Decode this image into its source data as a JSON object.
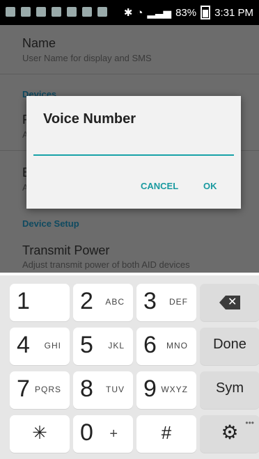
{
  "status_bar": {
    "battery_percent": "83%",
    "time": "3:31 PM",
    "icons": [
      "message-icon",
      "app-icon",
      "app-icon",
      "app-icon",
      "instagram-icon",
      "keyboard-icon",
      "image-icon",
      "bluetooth-icon",
      "wifi-icon",
      "signal-icon",
      "battery-icon"
    ]
  },
  "settings": {
    "name": {
      "title": "Name",
      "subtitle": "User Name for display and SMS"
    },
    "devices_section": "Devices",
    "device_setup_section": "Device Setup",
    "transmit_power": {
      "title": "Transmit Power",
      "subtitle": "Adjust transmit power of both AID devices"
    },
    "partial_item1": {
      "letter": "F",
      "sub_letter": "A"
    },
    "partial_item2": {
      "letter": "E",
      "sub_letter": "A"
    }
  },
  "dialog": {
    "title": "Voice Number",
    "input_value": "",
    "cancel_label": "CANCEL",
    "ok_label": "OK"
  },
  "keyboard": {
    "row1": [
      {
        "main": "1",
        "sub": ""
      },
      {
        "main": "2",
        "sub": "ABC"
      },
      {
        "main": "3",
        "sub": "DEF"
      },
      {
        "main": "",
        "sub": "",
        "icon": "backspace-icon"
      }
    ],
    "row2": [
      {
        "main": "4",
        "sub": "GHI"
      },
      {
        "main": "5",
        "sub": "JKL"
      },
      {
        "main": "6",
        "sub": "MNO"
      },
      {
        "main": "Done",
        "sub": ""
      }
    ],
    "row3": [
      {
        "main": "7",
        "sub": "PQRS"
      },
      {
        "main": "8",
        "sub": "TUV"
      },
      {
        "main": "9",
        "sub": "WXYZ"
      },
      {
        "main": "Sym",
        "sub": ""
      }
    ],
    "row4": [
      {
        "main": "✳",
        "sub": ""
      },
      {
        "main": "0",
        "sub": "+"
      },
      {
        "main": "#",
        "sub": ""
      },
      {
        "main": "",
        "sub": "",
        "icon": "settings-icon"
      }
    ]
  },
  "colors": {
    "accent": "#1a9aa0",
    "overlay_dim": "#6c6c6c"
  }
}
